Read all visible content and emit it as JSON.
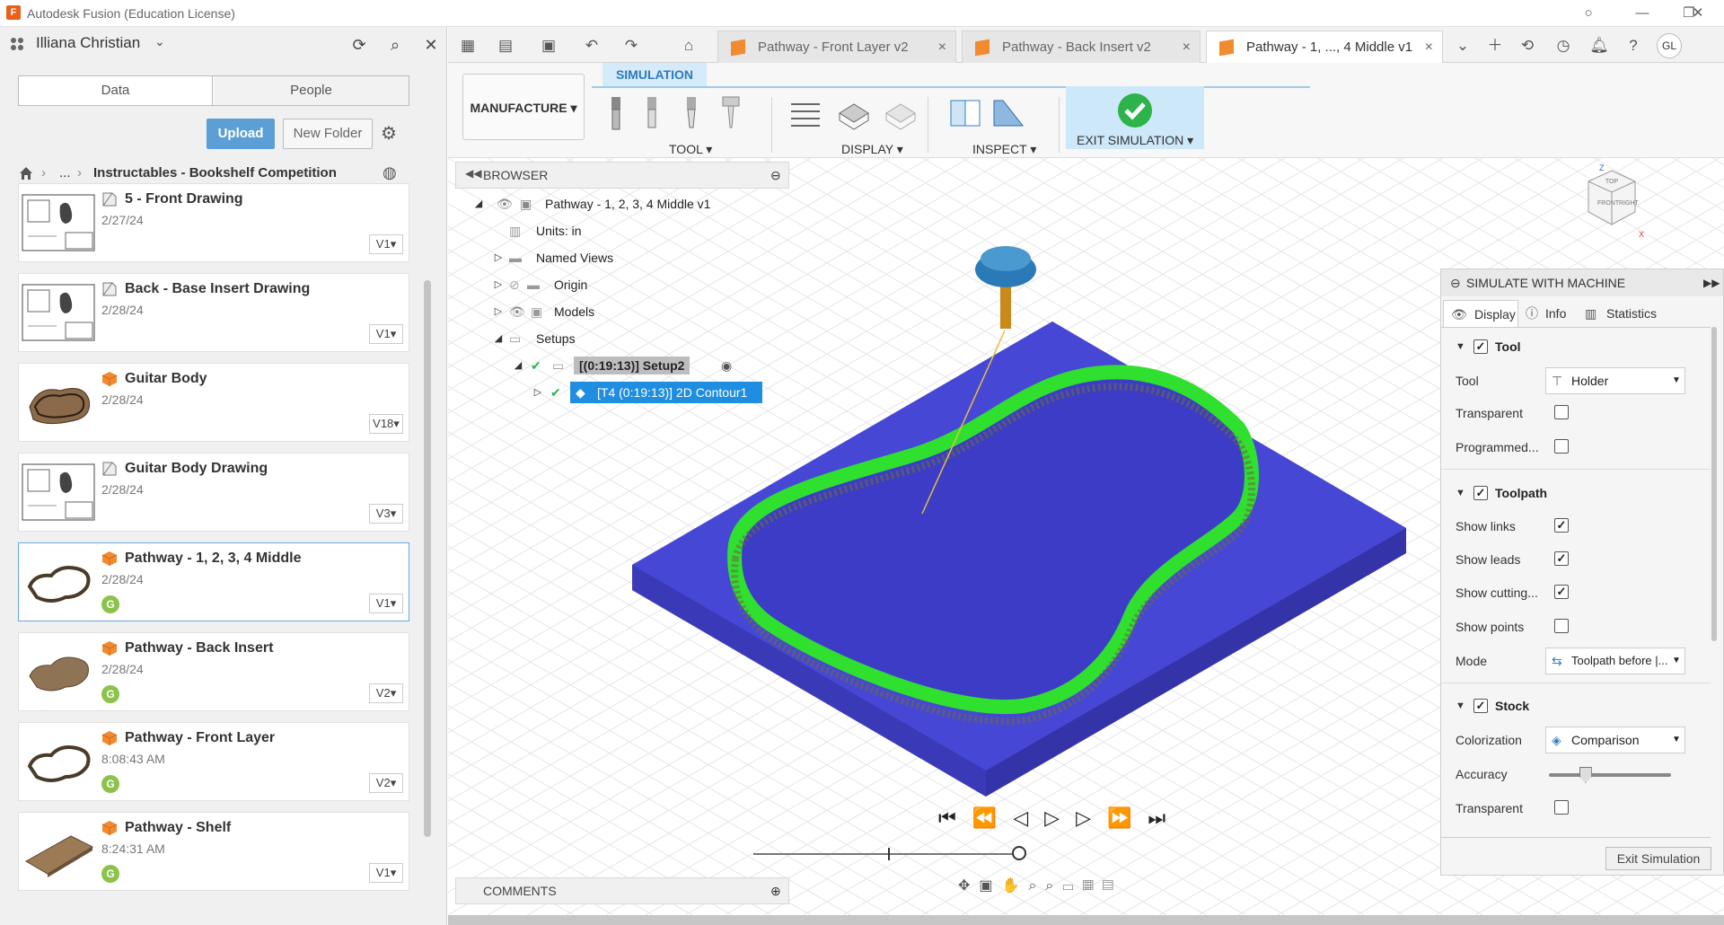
{
  "window": {
    "title": "Autodesk Fusion (Education License)"
  },
  "left_panel": {
    "user": "Illiana Christian",
    "tabs": [
      "Data",
      "People"
    ],
    "upload_label": "Upload",
    "new_folder_label": "New Folder",
    "breadcrumb": {
      "ellipsis": "...",
      "current": "Instructables - Bookshelf Competition"
    },
    "items": [
      {
        "name": "5 - Front Drawing",
        "date": "2/27/24",
        "version": "V1",
        "type": "drawing"
      },
      {
        "name": "Back - Base Insert Drawing",
        "date": "2/28/24",
        "version": "V1",
        "type": "drawing"
      },
      {
        "name": "Guitar Body",
        "date": "2/28/24",
        "version": "V18",
        "type": "model"
      },
      {
        "name": "Guitar Body Drawing",
        "date": "2/28/24",
        "version": "V3",
        "type": "drawing"
      },
      {
        "name": "Pathway - 1, 2, 3, 4 Middle",
        "date": "2/28/24",
        "version": "V1",
        "type": "model",
        "badge": "G"
      },
      {
        "name": "Pathway - Back Insert",
        "date": "2/28/24",
        "version": "V2",
        "type": "model",
        "badge": "G"
      },
      {
        "name": "Pathway - Front Layer",
        "date": "8:08:43 AM",
        "version": "V2",
        "type": "model",
        "badge": "G"
      },
      {
        "name": "Pathway - Shelf",
        "date": "8:24:31 AM",
        "version": "V1",
        "type": "model",
        "badge": "G"
      }
    ]
  },
  "doc_tabs": [
    {
      "label": "Pathway - Front Layer v2",
      "close": "×"
    },
    {
      "label": "Pathway - Back Insert v2",
      "close": "×"
    },
    {
      "label": "Pathway - 1, ..., 4 Middle v1",
      "close": "×"
    }
  ],
  "account_initials": "GL",
  "ribbon": {
    "workspace": "MANUFACTURE",
    "active_tab": "SIMULATION",
    "groups": [
      "TOOL",
      "DISPLAY",
      "INSPECT",
      "EXIT SIMULATION"
    ]
  },
  "browser": {
    "title": "BROWSER",
    "root": "Pathway - 1, 2, 3, 4 Middle v1",
    "nodes": [
      "Units: in",
      "Named Views",
      "Origin",
      "Models",
      "Setups"
    ],
    "setup": "[(0:19:13)] Setup2",
    "operation": "[T4 (0:19:13)] 2D Contour1"
  },
  "comments_label": "COMMENTS",
  "viewcube": {
    "top": "TOP",
    "front": "FRONT",
    "right": "RIGHT",
    "z": "Z",
    "x": "X"
  },
  "sim_panel": {
    "title": "SIMULATE WITH MACHINE",
    "tabs": [
      "Display",
      "Info",
      "Statistics"
    ],
    "tool_section": "Tool",
    "tool_label": "Tool",
    "tool_value": "Holder",
    "transparent_label": "Transparent",
    "programmed_label": "Programmed...",
    "toolpath_section": "Toolpath",
    "show_links": "Show links",
    "show_leads": "Show leads",
    "show_cutting": "Show cutting...",
    "show_points": "Show points",
    "mode_label": "Mode",
    "mode_value": "Toolpath before |...",
    "stock_section": "Stock",
    "colorization_label": "Colorization",
    "colorization_value": "Comparison",
    "accuracy_label": "Accuracy",
    "stock_transparent_label": "Transparent",
    "exit_label": "Exit Simulation",
    "accuracy_level": 0.3
  },
  "playback_progress": 0.5,
  "colors": {
    "stock": "#4747d6",
    "cut": "#3cf03c",
    "accent": "#2e7bbf",
    "selection": "#1f8ee0"
  }
}
